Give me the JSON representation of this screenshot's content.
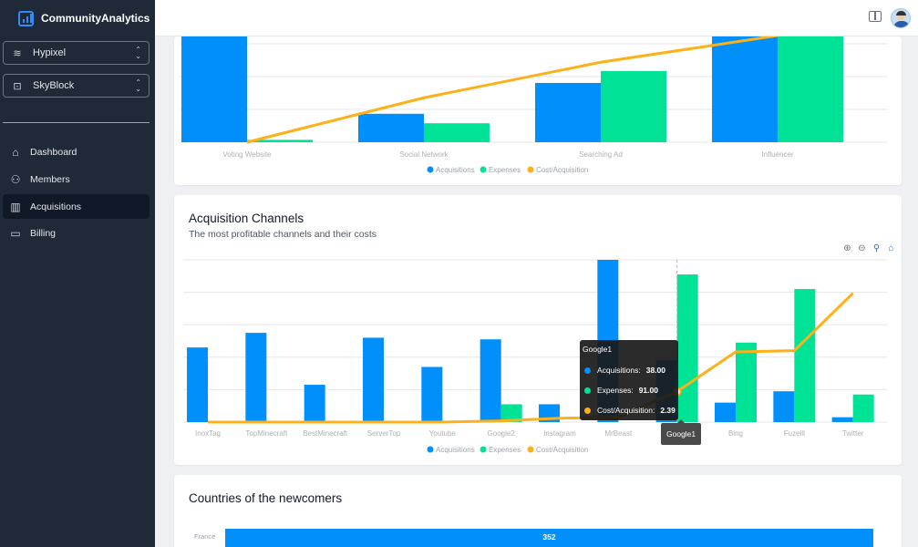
{
  "app": {
    "title": "CommunityAnalytics"
  },
  "selects": [
    {
      "icon": "layers-icon",
      "value": "Hypixel"
    },
    {
      "icon": "terminal-icon",
      "value": "SkyBlock"
    }
  ],
  "nav": [
    {
      "id": "dashboard",
      "label": "Dashboard",
      "icon": "home-icon",
      "active": false
    },
    {
      "id": "members",
      "label": "Members",
      "icon": "users-icon",
      "active": false
    },
    {
      "id": "acquisitions",
      "label": "Acquisitions",
      "icon": "bar-chart-icon",
      "active": true
    },
    {
      "id": "billing",
      "label": "Billing",
      "icon": "credit-card-icon",
      "active": false
    }
  ],
  "colors": {
    "acquisitions": "#008ffb",
    "expenses": "#00e396",
    "cost": "#feb019",
    "sidebar": "#1f2937"
  },
  "legend": [
    "Acquisitions",
    "Expenses",
    "Cost/Acquisition"
  ],
  "top_chart": {
    "chart_data": {
      "type": "bar",
      "categories": [
        "Voting Website",
        "Social Network",
        "Searching Ad",
        "Influencer"
      ],
      "series": [
        {
          "name": "Acquisitions",
          "type": "bar",
          "values": [
            45,
            12,
            25,
            45
          ]
        },
        {
          "name": "Expenses",
          "type": "bar",
          "values": [
            1,
            8,
            30,
            45
          ]
        },
        {
          "name": "Cost/Acquisition",
          "type": "line",
          "values": [
            0,
            25,
            45,
            60
          ]
        }
      ],
      "legend_position": "bottom"
    }
  },
  "channels": {
    "title": "Acquisition Channels",
    "subtitle": "The most profitable channels and their costs",
    "chart_data": {
      "type": "bar",
      "categories": [
        "InoxTag",
        "TopMinecraft",
        "BestMinecraft",
        "ServerTop",
        "Youtube",
        "Google2",
        "Instagram",
        "MrBeast",
        "Google1",
        "Bing",
        "Fuzelll",
        "Twitter"
      ],
      "series": [
        {
          "name": "Acquisitions",
          "type": "bar",
          "values": [
            46,
            55,
            23,
            52,
            34,
            51,
            11,
            100,
            38,
            12,
            19,
            3
          ]
        },
        {
          "name": "Expenses",
          "type": "bar",
          "values": [
            0,
            0,
            0,
            0,
            0,
            11,
            0,
            0,
            91,
            49,
            82,
            17
          ]
        },
        {
          "name": "Cost/Acquisition",
          "type": "line",
          "values": [
            0,
            0,
            0,
            0,
            0,
            0.1,
            0.3,
            0.4,
            2.39,
            5.5,
            5.6,
            10.1
          ]
        }
      ],
      "legend_position": "bottom"
    },
    "tooltip": {
      "title": "Google1",
      "rows": [
        {
          "label": "Acquisitions:",
          "value": "38.00"
        },
        {
          "label": "Expenses:",
          "value": "91.00"
        },
        {
          "label": "Cost/Acquisition:",
          "value": "2.39"
        }
      ],
      "x_label": "Google1"
    }
  },
  "countries": {
    "title": "Countries of the newcomers",
    "chart_data": {
      "type": "bar",
      "orientation": "horizontal",
      "categories": [
        "France"
      ],
      "values": [
        352
      ]
    }
  }
}
